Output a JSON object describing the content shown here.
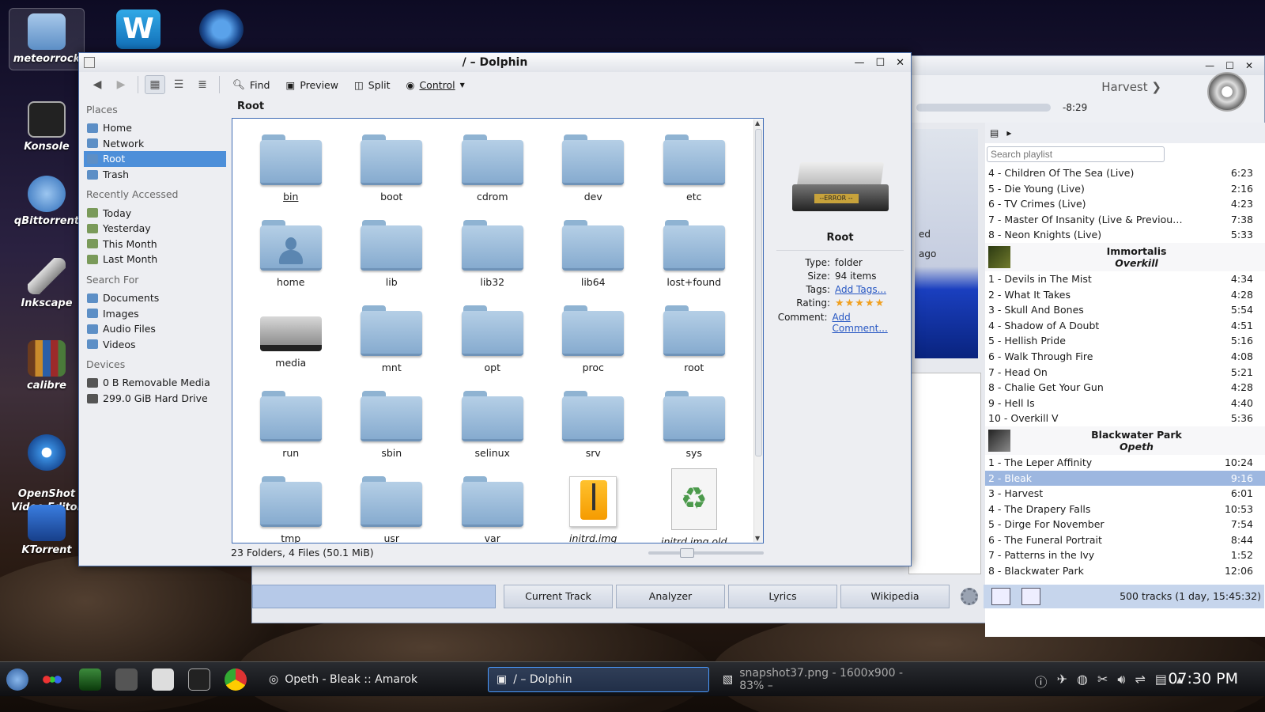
{
  "desktop": {
    "icons": [
      {
        "label": "meteorrock"
      },
      {
        "label": "Konsole"
      },
      {
        "label": "qBittorrent"
      },
      {
        "label": "Inkscape"
      },
      {
        "label": "calibre"
      },
      {
        "label": "OpenShot\nVideo Editor"
      },
      {
        "label": "KTorrent"
      }
    ]
  },
  "dolphin": {
    "title": "/ – Dolphin",
    "toolbar": {
      "find": "Find",
      "preview": "Preview",
      "split": "Split",
      "control": "Control"
    },
    "places": {
      "places_header": "Places",
      "places_items": [
        "Home",
        "Network",
        "Root",
        "Trash"
      ],
      "recent_header": "Recently Accessed",
      "recent_items": [
        "Today",
        "Yesterday",
        "This Month",
        "Last Month"
      ],
      "search_header": "Search For",
      "search_items": [
        "Documents",
        "Images",
        "Audio Files",
        "Videos"
      ],
      "devices_header": "Devices",
      "devices_items": [
        "0 B Removable Media",
        "299.0 GiB Hard Drive"
      ]
    },
    "location": "Root",
    "files": [
      "bin",
      "boot",
      "cdrom",
      "dev",
      "etc",
      "home",
      "lib",
      "lib32",
      "lib64",
      "lost+found",
      "media",
      "mnt",
      "opt",
      "proc",
      "root",
      "run",
      "sbin",
      "selinux",
      "srv",
      "sys",
      "tmp",
      "usr",
      "var",
      "initrd.img",
      "initrd.img.old"
    ],
    "info": {
      "name": "Root",
      "drive_label": "--ERROR --",
      "type_key": "Type:",
      "type_val": "folder",
      "size_key": "Size:",
      "size_val": "94 items",
      "tags_key": "Tags:",
      "tags_val": "Add Tags...",
      "rating_key": "Rating:",
      "rating_val": "★★★★★",
      "comment_key": "Comment:",
      "comment_val": "Add Comment..."
    },
    "status": "23 Folders, 4 Files (50.1 MiB)"
  },
  "amarok": {
    "next_track": "Harvest",
    "time_remaining": "-8:29",
    "center_labels": [
      "ed",
      "ago"
    ],
    "search_placeholder": "Search playlist",
    "playlist_top": [
      {
        "t": "4 - Children Of The Sea (Live)",
        "d": "6:23"
      },
      {
        "t": "5 - Die Young (Live)",
        "d": "2:16"
      },
      {
        "t": "6 - TV Crimes (Live)",
        "d": "4:23"
      },
      {
        "t": "7 - Master Of Insanity (Live & Previously ...",
        "d": "7:38"
      },
      {
        "t": "8 - Neon Knights (Live)",
        "d": "5:33"
      }
    ],
    "album1": {
      "artist": "Immortalis",
      "album": "Overkill"
    },
    "playlist_mid": [
      {
        "t": "1 - Devils in The Mist",
        "d": "4:34"
      },
      {
        "t": "2 - What It Takes",
        "d": "4:28"
      },
      {
        "t": "3 - Skull And Bones",
        "d": "5:54"
      },
      {
        "t": "4 - Shadow of A Doubt",
        "d": "4:51"
      },
      {
        "t": "5 - Hellish Pride",
        "d": "5:16"
      },
      {
        "t": "6 - Walk Through Fire",
        "d": "4:08"
      },
      {
        "t": "7 - Head On",
        "d": "5:21"
      },
      {
        "t": "8 - Chalie Get Your Gun",
        "d": "4:28"
      },
      {
        "t": "9 - Hell Is",
        "d": "4:40"
      },
      {
        "t": "10 - Overkill V",
        "d": "5:36"
      }
    ],
    "album2": {
      "artist": "Blackwater Park",
      "album": "Opeth"
    },
    "playlist_bottom": [
      {
        "t": "1 - The Leper Affinity",
        "d": "10:24"
      },
      {
        "t": "2 - Bleak",
        "d": "9:16"
      },
      {
        "t": "3 - Harvest",
        "d": "6:01"
      },
      {
        "t": "4 - The Drapery Falls",
        "d": "10:53"
      },
      {
        "t": "5 - Dirge For November",
        "d": "7:54"
      },
      {
        "t": "6 - The Funeral Portrait",
        "d": "8:44"
      },
      {
        "t": "7 - Patterns in the Ivy",
        "d": "1:52"
      },
      {
        "t": "8 - Blackwater Park",
        "d": "12:06"
      }
    ],
    "tabs": [
      "Current Track",
      "Analyzer",
      "Lyrics",
      "Wikipedia"
    ],
    "track_count": "500 tracks (1 day, 15:45:32)"
  },
  "taskbar": {
    "tasks": [
      {
        "label": "Opeth - Bleak  ::  Amarok"
      },
      {
        "label": "/ – Dolphin"
      },
      {
        "label": "snapshot37.png - 1600x900 - 83% –"
      }
    ],
    "clock": "07:30 PM"
  }
}
